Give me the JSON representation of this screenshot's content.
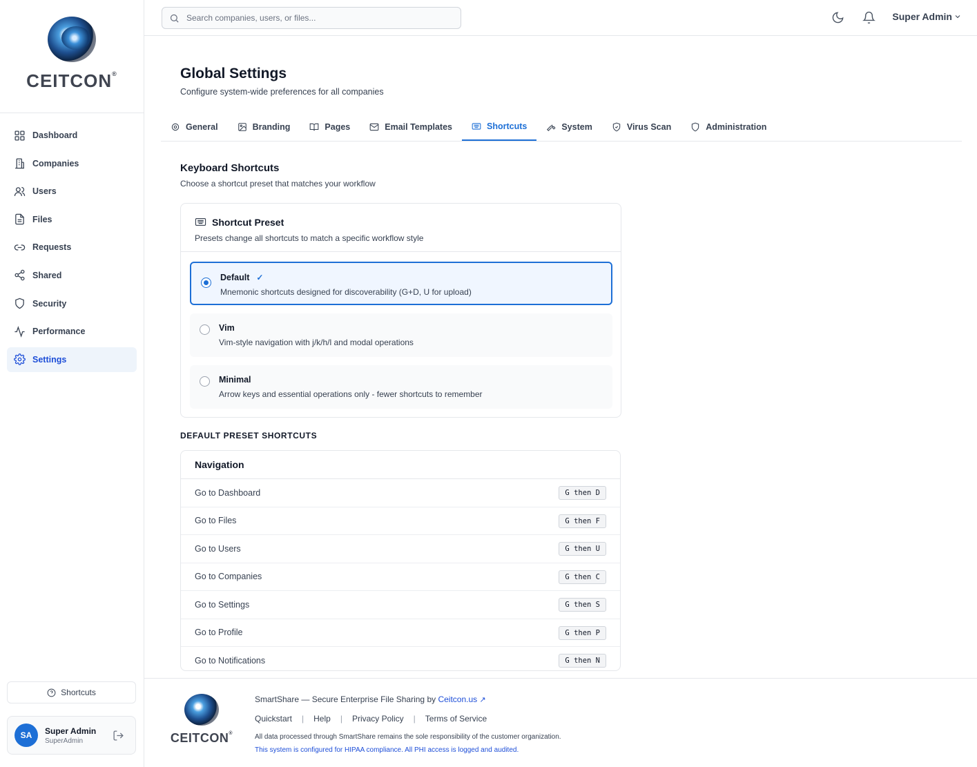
{
  "brand": {
    "name": "CEITCON",
    "reg": "®"
  },
  "sidebar": {
    "items": [
      {
        "label": "Dashboard"
      },
      {
        "label": "Companies"
      },
      {
        "label": "Users"
      },
      {
        "label": "Files"
      },
      {
        "label": "Requests"
      },
      {
        "label": "Shared"
      },
      {
        "label": "Security"
      },
      {
        "label": "Performance"
      },
      {
        "label": "Settings"
      }
    ],
    "active": "Settings",
    "shortcuts_label": "Shortcuts",
    "user": {
      "initials": "SA",
      "name": "Super Admin",
      "role": "SuperAdmin"
    }
  },
  "topbar": {
    "search_placeholder": "Search companies, users, or files...",
    "user_menu": "Super Admin"
  },
  "page": {
    "title": "Global Settings",
    "subtitle": "Configure system-wide preferences for all companies",
    "tabs": [
      {
        "label": "General"
      },
      {
        "label": "Branding"
      },
      {
        "label": "Pages"
      },
      {
        "label": "Email Templates"
      },
      {
        "label": "Shortcuts"
      },
      {
        "label": "System"
      },
      {
        "label": "Virus Scan"
      },
      {
        "label": "Administration"
      }
    ],
    "active_tab": "Shortcuts"
  },
  "shortcuts": {
    "title": "Keyboard Shortcuts",
    "subtitle": "Choose a shortcut preset that matches your workflow",
    "preset_card": {
      "title": "Shortcut Preset",
      "description": "Presets change all shortcuts to match a specific workflow style",
      "options": [
        {
          "name": "Default",
          "description": "Mnemonic shortcuts designed for discoverability (G+D, U for upload)",
          "selected": true
        },
        {
          "name": "Vim",
          "description": "Vim-style navigation with j/k/h/l and modal operations",
          "selected": false
        },
        {
          "name": "Minimal",
          "description": "Arrow keys and essential operations only - fewer shortcuts to remember",
          "selected": false
        }
      ]
    },
    "preset_section_label": "DEFAULT PRESET SHORTCUTS",
    "navigation": {
      "title": "Navigation",
      "rows": [
        {
          "label": "Go to Dashboard",
          "keys": "G then D"
        },
        {
          "label": "Go to Files",
          "keys": "G then F"
        },
        {
          "label": "Go to Users",
          "keys": "G then U"
        },
        {
          "label": "Go to Companies",
          "keys": "G then C"
        },
        {
          "label": "Go to Settings",
          "keys": "G then S"
        },
        {
          "label": "Go to Profile",
          "keys": "G then P"
        },
        {
          "label": "Go to Notifications",
          "keys": "G then N"
        }
      ]
    }
  },
  "footer": {
    "tagline": "SmartShare — Secure Enterprise File Sharing by ",
    "link": "Ceitcon.us",
    "links": [
      "Quickstart",
      "Help",
      "Privacy Policy",
      "Terms of Service"
    ],
    "disclaimer": "All data processed through SmartShare remains the sole responsibility of the customer organization.",
    "hipaa": "This system is configured for HIPAA compliance. All PHI access is logged and audited."
  },
  "colors": {
    "accent": "#1d6fd6",
    "active_bg": "#eef4fb",
    "border": "#e5e7eb"
  }
}
